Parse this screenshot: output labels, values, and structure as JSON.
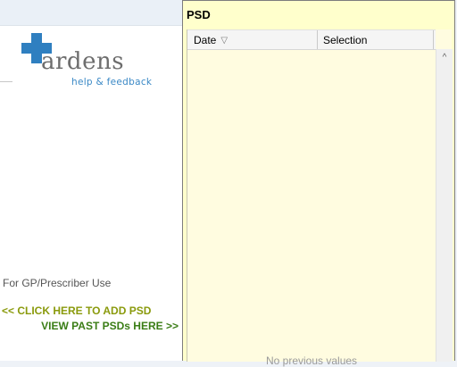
{
  "left": {
    "logo_word": "ardens",
    "logo_sub": "help & feedback",
    "gp_text": "For GP/Prescriber Use",
    "add_link": "<< CLICK HERE TO ADD PSD",
    "past_link": "VIEW PAST PSDs HERE >>"
  },
  "psd": {
    "title": "PSD",
    "columns": {
      "date": "Date",
      "selection": "Selection"
    },
    "empty_text": "No previous values"
  },
  "icons": {
    "sort": "sort-desc-icon",
    "scroll_up": "chevron-up-icon"
  },
  "colors": {
    "accent_blue": "#2f7fc0",
    "add_link": "#8a9a0c",
    "past_link": "#3a7d16",
    "panel_bg": "#ffffcc"
  }
}
